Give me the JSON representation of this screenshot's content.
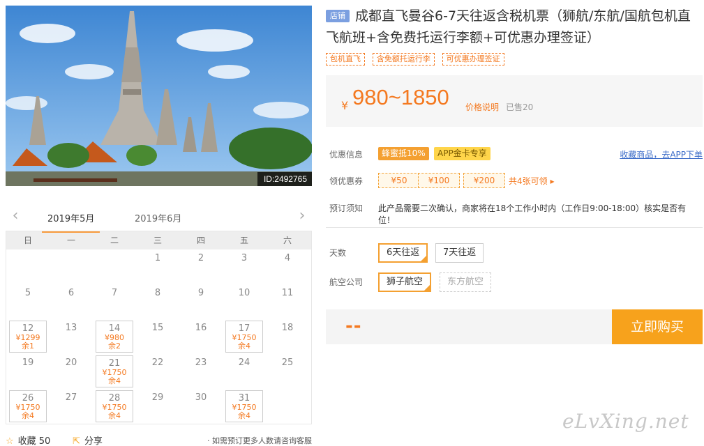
{
  "hero": {
    "id_label": "ID:2492765"
  },
  "calendar": {
    "prev": "‹",
    "next": "›",
    "months": [
      "2019年5月",
      "2019年6月"
    ],
    "weekdays": [
      "日",
      "一",
      "二",
      "三",
      "四",
      "五",
      "六"
    ],
    "days": [
      {
        "col": 3,
        "day": "1"
      },
      {
        "col": 4,
        "day": "2"
      },
      {
        "col": 5,
        "day": "3"
      },
      {
        "col": 6,
        "day": "4"
      },
      {
        "col": 0,
        "day": "5"
      },
      {
        "col": 1,
        "day": "6"
      },
      {
        "col": 2,
        "day": "7"
      },
      {
        "col": 3,
        "day": "8"
      },
      {
        "col": 4,
        "day": "9"
      },
      {
        "col": 5,
        "day": "10"
      },
      {
        "col": 6,
        "day": "11"
      },
      {
        "col": 0,
        "day": "12",
        "price": "¥1299",
        "left": "余1"
      },
      {
        "col": 1,
        "day": "13"
      },
      {
        "col": 2,
        "day": "14",
        "price": "¥980",
        "left": "余2"
      },
      {
        "col": 3,
        "day": "15"
      },
      {
        "col": 4,
        "day": "16"
      },
      {
        "col": 5,
        "day": "17",
        "price": "¥1750",
        "left": "余4"
      },
      {
        "col": 6,
        "day": "18"
      },
      {
        "col": 0,
        "day": "19"
      },
      {
        "col": 1,
        "day": "20"
      },
      {
        "col": 2,
        "day": "21",
        "price": "¥1750",
        "left": "余4"
      },
      {
        "col": 3,
        "day": "22"
      },
      {
        "col": 4,
        "day": "23"
      },
      {
        "col": 5,
        "day": "24"
      },
      {
        "col": 6,
        "day": "25"
      },
      {
        "col": 0,
        "day": "26",
        "price": "¥1750",
        "left": "余4"
      },
      {
        "col": 1,
        "day": "27"
      },
      {
        "col": 2,
        "day": "28",
        "price": "¥1750",
        "left": "余4"
      },
      {
        "col": 3,
        "day": "29"
      },
      {
        "col": 4,
        "day": "30"
      },
      {
        "col": 5,
        "day": "31",
        "price": "¥1750",
        "left": "余4"
      }
    ]
  },
  "footer": {
    "fav_label": "收藏 50",
    "share_label": "分享",
    "note": "· 如需预订更多人数请咨询客服"
  },
  "product": {
    "shop_badge": "店铺",
    "title": "成都直飞曼谷6-7天往返含税机票（狮航/东航/国航包机直飞航班+含免费托运行李额+可优惠办理签证）",
    "tags": [
      "包机直飞",
      "含免额托运行李",
      "可优惠办理签证"
    ],
    "price_yen": "¥",
    "price": "980~1850",
    "price_note": "价格说明",
    "sold": "已售20"
  },
  "promo": {
    "label": "优惠信息",
    "badges": [
      "蜂蜜抵10%",
      "APP金卡专享"
    ],
    "fav_link": "收藏商品，去APP下单"
  },
  "coupons": {
    "label": "领优惠券",
    "items": [
      "¥50",
      "¥100",
      "¥200"
    ],
    "more": "共4张可领 ▸"
  },
  "notice": {
    "label": "预订须知",
    "text": "此产品需要二次确认，商家将在18个工作小时内（工作日9:00-18:00）核实是否有位！"
  },
  "options": {
    "days_label": "天数",
    "days": [
      "6天往返",
      "7天往返"
    ],
    "airline_label": "航空公司",
    "airlines": [
      "狮子航空",
      "东方航空"
    ]
  },
  "buy": {
    "price": "--",
    "button": "立即购买"
  },
  "watermark": "eLvXing.net",
  "colors": {
    "accent": "#f47920",
    "button": "#f7a21c",
    "link": "#3a6bc8"
  }
}
